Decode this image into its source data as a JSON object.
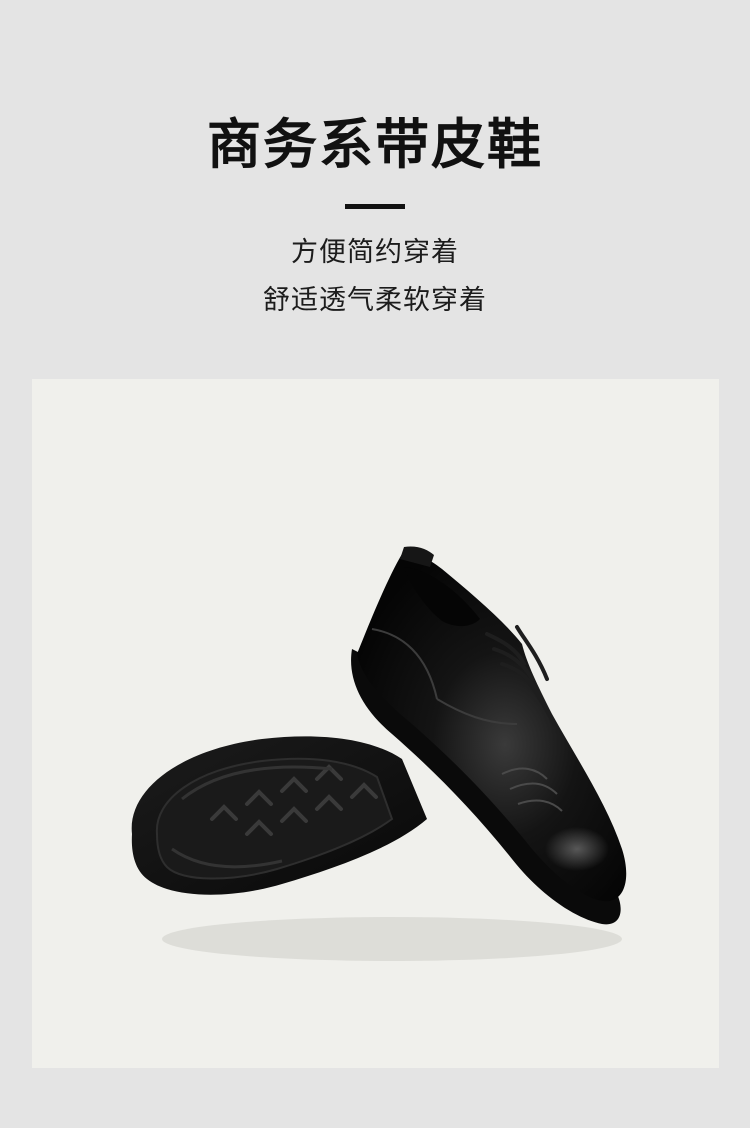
{
  "header": {
    "title": "商务系带皮鞋",
    "subtitle_lines": [
      "方便简约穿着",
      "舒适透气柔软穿着"
    ]
  },
  "photo": {
    "subject": "black-leather-lace-up-dress-shoes",
    "background_color": "#f0f0ec"
  },
  "colors": {
    "page_background": "#e4e4e4",
    "text_primary": "#111111",
    "shoe_black": "#0c0c0c"
  }
}
